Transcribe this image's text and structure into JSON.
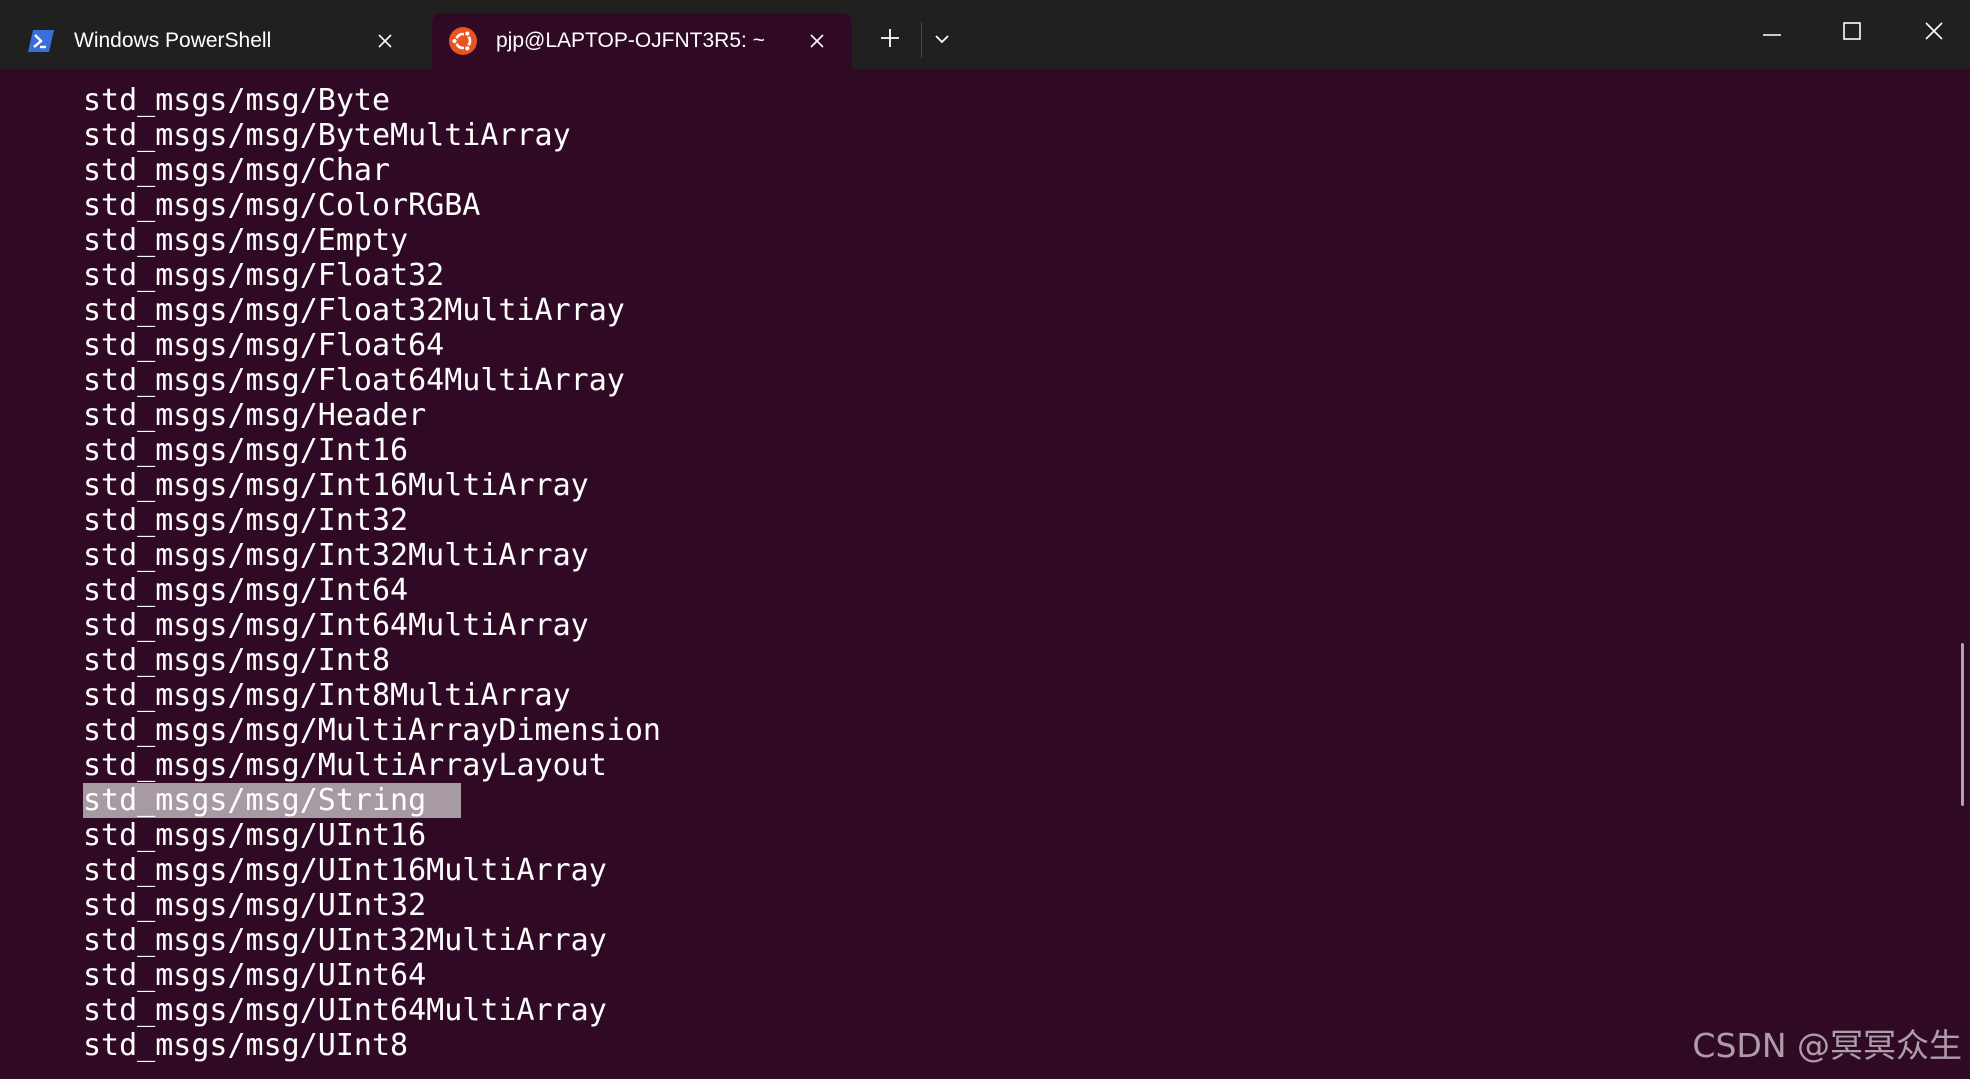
{
  "colors": {
    "titlebar_bg": "#202020",
    "terminal_bg": "#300a24",
    "text": "#ffffff",
    "selection_bg": "#a79aa2",
    "ubuntu_orange": "#e95420",
    "powershell_blue": "#3a6fd8"
  },
  "tabs": [
    {
      "label": "Windows PowerShell",
      "icon": "powershell-icon",
      "active": false
    },
    {
      "label": "pjp@LAPTOP-OJFNT3R5: ~",
      "icon": "ubuntu-icon",
      "active": true
    }
  ],
  "toolbar": {
    "new_tab_icon": "plus-icon",
    "dropdown_icon": "chevron-down-icon"
  },
  "window_controls": [
    "minimize-icon",
    "maximize-icon",
    "close-icon"
  ],
  "terminal": {
    "selected_index": 20,
    "lines": [
      "std_msgs/msg/Byte",
      "std_msgs/msg/ByteMultiArray",
      "std_msgs/msg/Char",
      "std_msgs/msg/ColorRGBA",
      "std_msgs/msg/Empty",
      "std_msgs/msg/Float32",
      "std_msgs/msg/Float32MultiArray",
      "std_msgs/msg/Float64",
      "std_msgs/msg/Float64MultiArray",
      "std_msgs/msg/Header",
      "std_msgs/msg/Int16",
      "std_msgs/msg/Int16MultiArray",
      "std_msgs/msg/Int32",
      "std_msgs/msg/Int32MultiArray",
      "std_msgs/msg/Int64",
      "std_msgs/msg/Int64MultiArray",
      "std_msgs/msg/Int8",
      "std_msgs/msg/Int8MultiArray",
      "std_msgs/msg/MultiArrayDimension",
      "std_msgs/msg/MultiArrayLayout",
      "std_msgs/msg/String",
      "std_msgs/msg/UInt16",
      "std_msgs/msg/UInt16MultiArray",
      "std_msgs/msg/UInt32",
      "std_msgs/msg/UInt32MultiArray",
      "std_msgs/msg/UInt64",
      "std_msgs/msg/UInt64MultiArray",
      "std_msgs/msg/UInt8"
    ]
  },
  "watermark": "CSDN @冥冥众生"
}
